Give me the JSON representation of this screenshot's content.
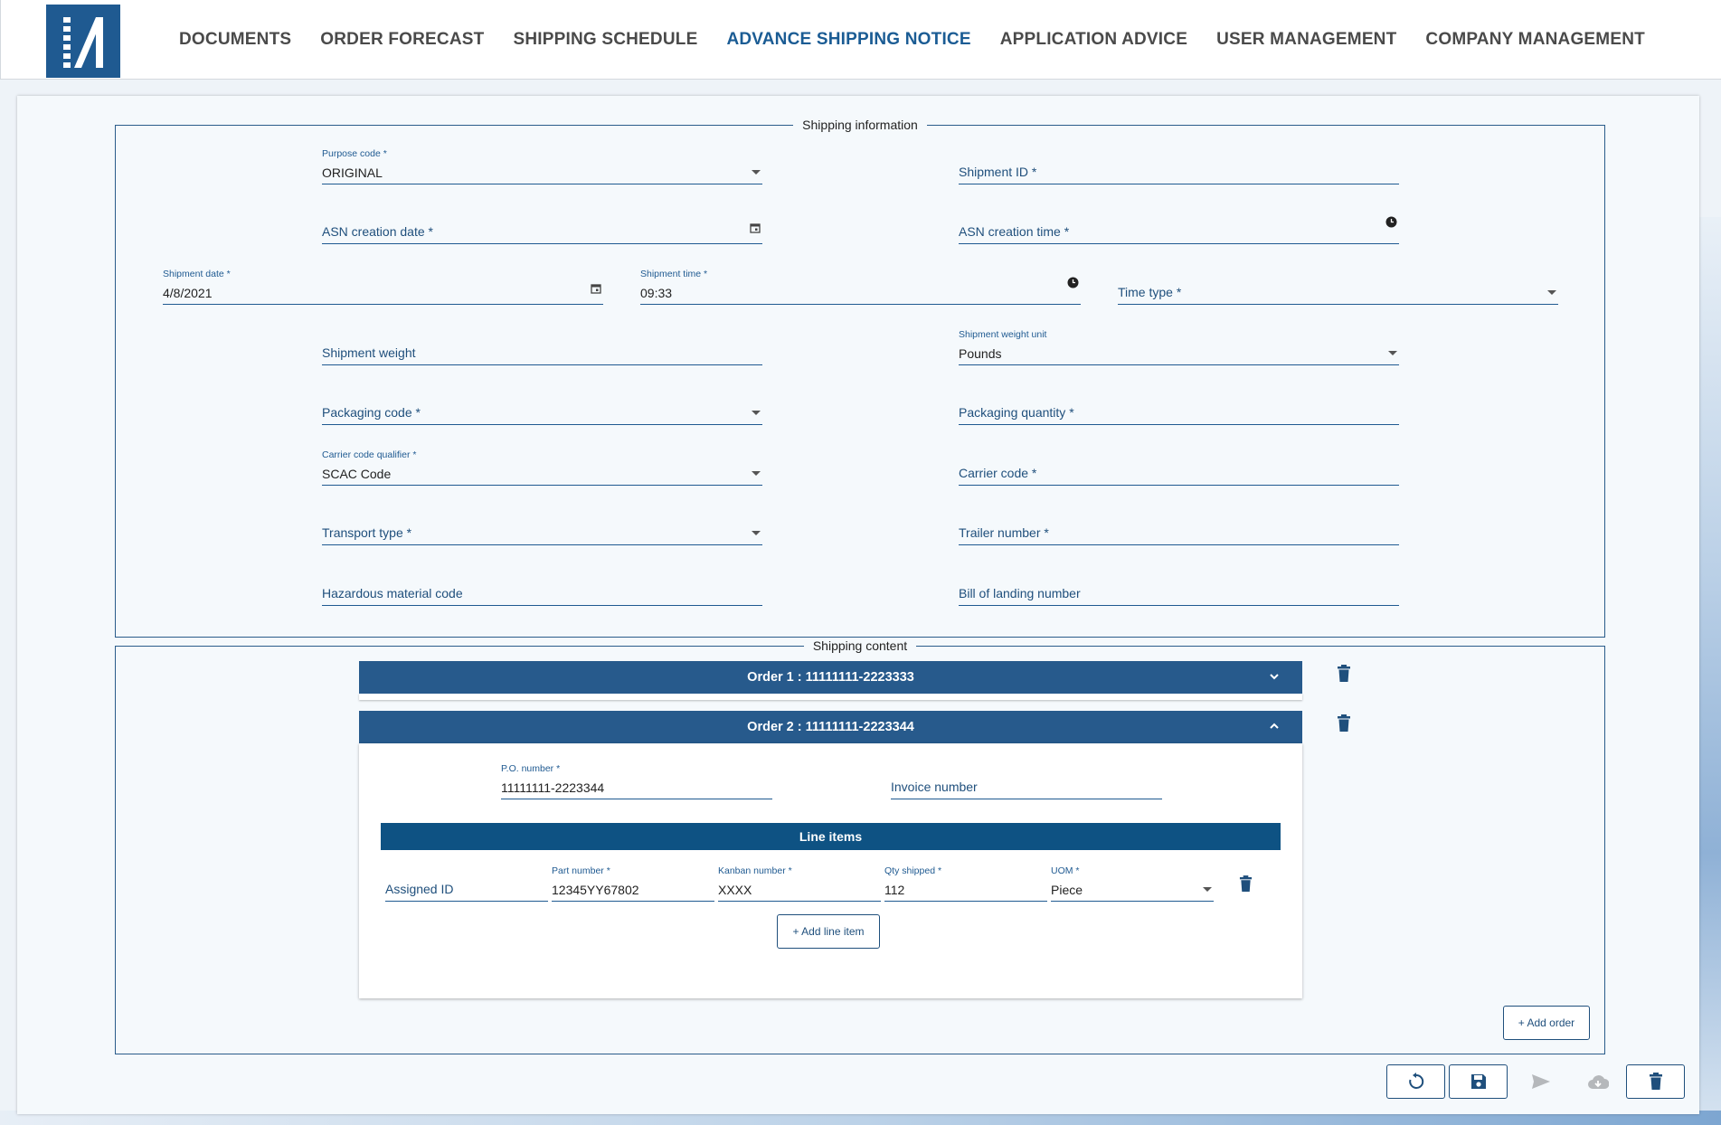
{
  "colors": {
    "primary": "#1f5a91",
    "order_header": "#275a8c",
    "line_items_bar": "#0e5283",
    "active_nav": "#1b5c94"
  },
  "nav": {
    "items": [
      {
        "label": "DOCUMENTS"
      },
      {
        "label": "ORDER FORECAST"
      },
      {
        "label": "SHIPPING SCHEDULE"
      },
      {
        "label": "ADVANCE SHIPPING NOTICE"
      },
      {
        "label": "APPLICATION ADVICE"
      },
      {
        "label": "USER MANAGEMENT"
      },
      {
        "label": "COMPANY MANAGEMENT"
      }
    ],
    "active": "ADVANCE SHIPPING NOTICE"
  },
  "shipping_info": {
    "legend": "Shipping information",
    "purpose_code": {
      "label": "Purpose code *",
      "value": "ORIGINAL"
    },
    "shipment_id": {
      "placeholder": "Shipment ID *"
    },
    "asn_creation_date": {
      "placeholder": "ASN creation date *"
    },
    "asn_creation_time": {
      "placeholder": "ASN creation time *"
    },
    "shipment_date": {
      "label": "Shipment date *",
      "value": "4/8/2021"
    },
    "shipment_time": {
      "label": "Shipment time *",
      "value": "09:33"
    },
    "time_type": {
      "placeholder": "Time type *"
    },
    "shipment_weight": {
      "placeholder": "Shipment weight"
    },
    "shipment_weight_unit": {
      "label": "Shipment weight unit",
      "value": "Pounds"
    },
    "packaging_code": {
      "placeholder": "Packaging code *"
    },
    "packaging_quantity": {
      "placeholder": "Packaging quantity *"
    },
    "carrier_code_qualifier": {
      "label": "Carrier code qualifier *",
      "value": "SCAC Code"
    },
    "carrier_code": {
      "placeholder": "Carrier code *"
    },
    "transport_type": {
      "placeholder": "Transport type *"
    },
    "trailer_number": {
      "placeholder": "Trailer number *"
    },
    "hazardous_material_code": {
      "placeholder": "Hazardous material code"
    },
    "bill_of_landing_number": {
      "placeholder": "Bill of landing number"
    }
  },
  "shipping_content": {
    "legend": "Shipping content",
    "orders": [
      {
        "title": "Order 1 : 11111111-2223333",
        "expanded": false
      },
      {
        "title": "Order 2 : 11111111-2223344",
        "expanded": true,
        "po_number": {
          "label": "P.O. number *",
          "value": "11111111-2223344"
        },
        "invoice_number": {
          "placeholder": "Invoice number"
        },
        "line_items_title": "Line items",
        "line_items": [
          {
            "assigned_id": {
              "placeholder": "Assigned ID"
            },
            "part_number": {
              "label": "Part number *",
              "value": "12345YY67802"
            },
            "kanban_number": {
              "label": "Kanban number *",
              "value": "XXXX"
            },
            "qty_shipped": {
              "label": "Qty shipped *",
              "value": "112"
            },
            "uom": {
              "label": "UOM *",
              "value": "Piece"
            }
          }
        ],
        "add_line_item_label": "+ Add line item"
      }
    ],
    "add_order_label": "+ Add order"
  },
  "actions": [
    {
      "icon": "reset-icon",
      "enabled": true
    },
    {
      "icon": "save-icon",
      "enabled": true
    },
    {
      "icon": "send-icon",
      "enabled": false
    },
    {
      "icon": "cloud-download-icon",
      "enabled": false
    },
    {
      "icon": "delete-icon",
      "enabled": true
    }
  ]
}
